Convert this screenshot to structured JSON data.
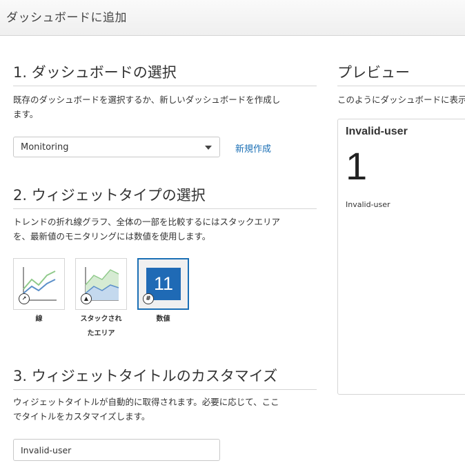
{
  "dialog": {
    "title": "ダッシュボードに追加"
  },
  "section1": {
    "title": "1. ダッシュボードの選択",
    "desc_line1": "既存のダッシュボードを選択するか、新しいダッシュボードを作成し",
    "desc_line2": "ます。",
    "dashboard_select": {
      "value": "Monitoring"
    },
    "create_new_label": "新規作成"
  },
  "section2": {
    "title": "2. ウィジェットタイプの選択",
    "desc_line1": "トレンドの折れ線グラフ、全体の一部を比較するにはスタックエリア",
    "desc_line2": "を、最新値のモニタリングには数値を使用します。",
    "widget_types": [
      {
        "label": "線",
        "icon": "line-chart-icon",
        "selected": false
      },
      {
        "label_line1": "スタックされ",
        "label_line2": "たエリア",
        "icon": "stacked-area-icon",
        "selected": false
      },
      {
        "label": "数値",
        "icon": "number-icon",
        "number": "11",
        "selected": true
      }
    ],
    "badge_hash": "#"
  },
  "section3": {
    "title": "3. ウィジェットタイトルのカスタマイズ",
    "desc_line1": "ウィジェットタイトルが自動的に取得されます。必要に応じて、ここ",
    "desc_line2": "でタイトルをカスタマイズします。",
    "title_input": {
      "value": "Invalid-user"
    }
  },
  "preview": {
    "title": "プレビュー",
    "desc": "このようにダッシュボードに表示されます",
    "card": {
      "title": "Invalid-user",
      "value": "1",
      "label": "Invalid-user"
    }
  },
  "colors": {
    "accent": "#1f6ab5",
    "link": "#1a6fb5",
    "border": "#d5d5d5"
  }
}
